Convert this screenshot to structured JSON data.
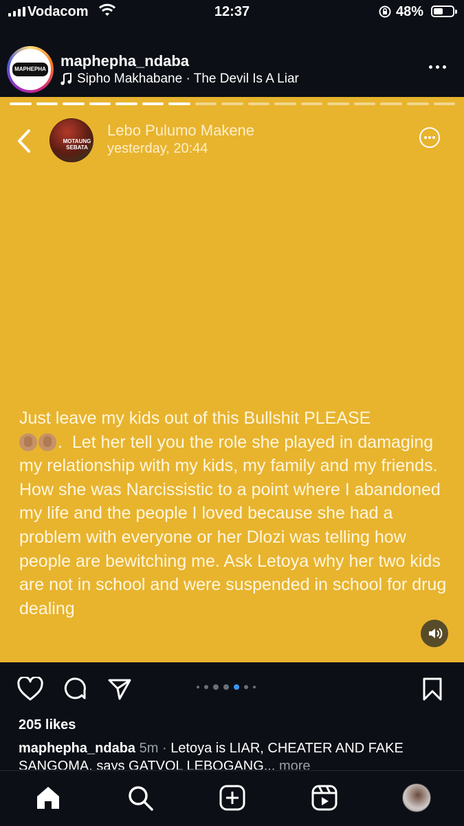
{
  "status_bar": {
    "carrier": "Vodacom",
    "time": "12:37",
    "battery_percent": "48%",
    "battery_level": 0.48
  },
  "post": {
    "username": "maphepha_ndaba",
    "avatar_text": "MAPHEPHA",
    "music": "Sipho Makhabane · The Devil Is A Liar",
    "story": {
      "background_color": "#e8b42e",
      "progress_segments_total": 17,
      "progress_segments_done": 7,
      "author": "Lebo  Pulumo Makene",
      "timestamp": "yesterday, 20:44",
      "author_avatar_text": "MOTAUNG SEBATA",
      "text_line1": "Just leave my kids out of this Bullshit PLEASE",
      "text_rest": "Let her tell you the role she played in damaging my relationship with my kids, my family and my friends. How she was Narcissistic to a point where I abandoned my life and the people I loved because she had a problem with everyone or her Dlozi was telling how people are bewitching me. Ask Letoya why her two kids are not in school and were suspended in school for drug dealing",
      "emoji": "clapping-hands-icon x2"
    },
    "pager": {
      "total": 7,
      "active_index": 4
    },
    "likes": "205 likes",
    "caption": {
      "username": "maphepha_ndaba",
      "time": "5m",
      "text": "Letoya is LIAR, CHEATER AND FAKE SANGOMA, says GATVOL LEBOGANG...",
      "more_label": "more"
    }
  },
  "bottom_nav": [
    "home-icon",
    "search-icon",
    "create-icon",
    "reels-icon",
    "profile-avatar"
  ],
  "colors": {
    "background": "#0c0f16",
    "accent_blue": "#3897f0"
  }
}
